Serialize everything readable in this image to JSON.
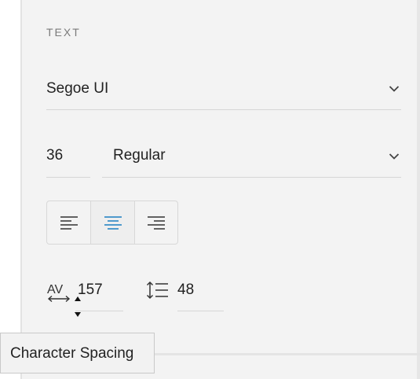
{
  "text_panel": {
    "section_title": "TEXT",
    "font_family": {
      "value": "Segoe UI",
      "chevron_icon": "chevron-down-icon"
    },
    "font_size": {
      "value": "36"
    },
    "font_weight": {
      "value": "Regular",
      "chevron_icon": "chevron-down-icon"
    },
    "alignment": {
      "options": [
        "align-left",
        "align-center",
        "align-right"
      ],
      "selected": "align-center",
      "accent_color": "#1a7fc1"
    },
    "character_spacing": {
      "icon_label": "AV",
      "value": "157"
    },
    "line_spacing": {
      "icon": "line-spacing-icon",
      "value": "48"
    }
  },
  "tooltip": {
    "text": "Character Spacing"
  }
}
